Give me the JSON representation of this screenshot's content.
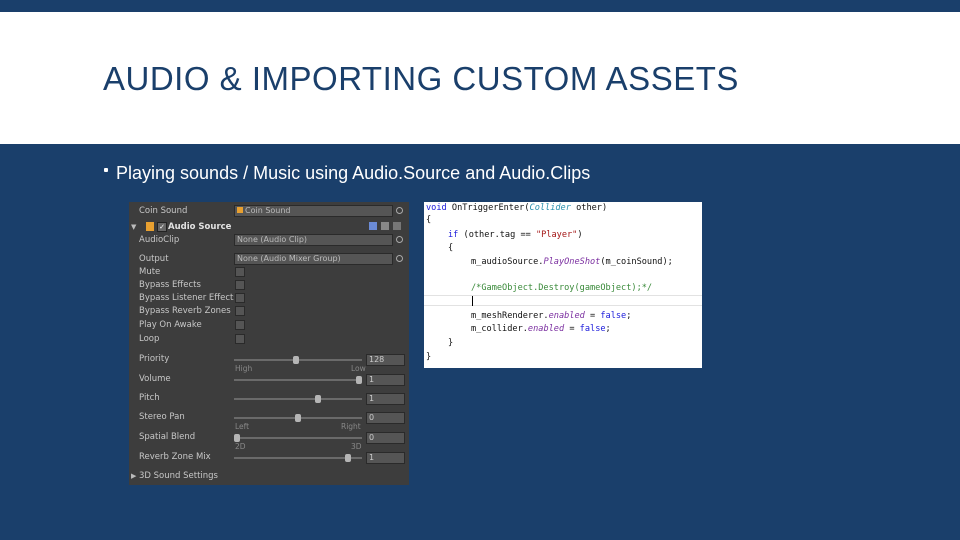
{
  "slide": {
    "title": "AUDIO & IMPORTING CUSTOM ASSETS",
    "bullet": "Playing sounds / Music using Audio.Source and Audio.Clips"
  },
  "colors": {
    "background": "#1a3f6b",
    "header": "#ffffff",
    "title_text": "#1a3f6b",
    "inspector_bg": "#3d3d3d",
    "audio_icon": "#e8a030"
  },
  "inspector": {
    "coin_sound": {
      "label": "Coin Sound",
      "value": "Coin Sound",
      "value_icon": "audio-clip-icon"
    },
    "component": {
      "name": "Audio Source",
      "enabled": true,
      "icon": "speaker-icon"
    },
    "audio_clip": {
      "label": "AudioClip",
      "value": "None (Audio Clip)"
    },
    "output": {
      "label": "Output",
      "value": "None (Audio Mixer Group)"
    },
    "toggles": [
      {
        "label": "Mute",
        "checked": false
      },
      {
        "label": "Bypass Effects",
        "checked": false
      },
      {
        "label": "Bypass Listener Effects",
        "checked": false
      },
      {
        "label": "Bypass Reverb Zones",
        "checked": false
      },
      {
        "label": "Play On Awake",
        "checked": false
      },
      {
        "label": "Loop",
        "checked": false
      }
    ],
    "priority": {
      "label": "Priority",
      "value": "128",
      "fraction": 0.5,
      "min_label": "High",
      "max_label": "Low"
    },
    "volume": {
      "label": "Volume",
      "value": "1",
      "fraction": 1.0
    },
    "pitch": {
      "label": "Pitch",
      "value": "1",
      "fraction": 0.66
    },
    "stereo_pan": {
      "label": "Stereo Pan",
      "value": "0",
      "fraction": 0.5,
      "min_label": "Left",
      "max_label": "Right"
    },
    "spatial_blend": {
      "label": "Spatial Blend",
      "value": "0",
      "fraction": 0.0,
      "min_label": "2D",
      "max_label": "3D"
    },
    "reverb_zone_mix": {
      "label": "Reverb Zone Mix",
      "value": "1",
      "fraction": 0.9
    },
    "settings_3d": {
      "label": "3D Sound Settings"
    }
  },
  "code": {
    "l1_void": "void",
    "l1_method": "OnTriggerEnter",
    "l1_open": "(",
    "l1_type": "Collider",
    "l1_rest": " other)",
    "l2": "{",
    "l3_kw": "if",
    "l3_mid": " (other.tag == ",
    "l3_str": "\"Player\"",
    "l3_end": ")",
    "l4": "{",
    "l5_obj": "m_audioSource.",
    "l5_method": "PlayOneShot",
    "l5_args": "(m_coinSound);",
    "l6_comment": "/*GameObject.Destroy(gameObject);*/",
    "l8_obj": "m_meshRenderer.",
    "l8_prop": "enabled",
    "l8_eq": " = ",
    "l8_val": "false",
    "l8_end": ";",
    "l9_obj": "m_collider.",
    "l9_prop": "enabled",
    "l9_eq": " = ",
    "l9_val": "false",
    "l9_end": ";",
    "l10": "}",
    "l11": "}"
  }
}
